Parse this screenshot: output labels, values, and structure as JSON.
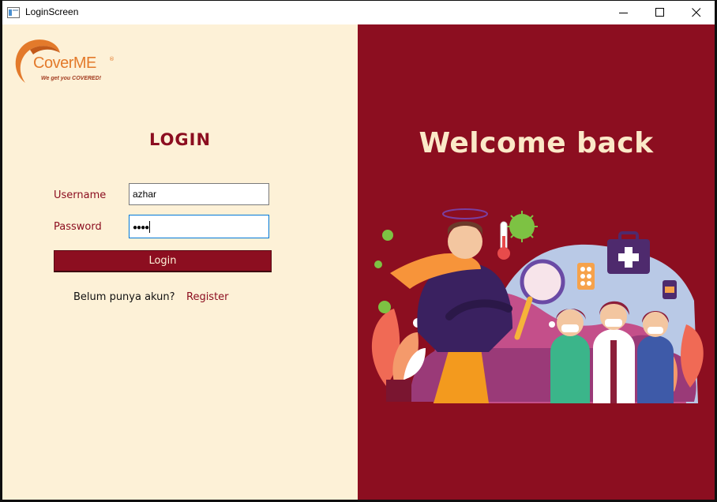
{
  "window": {
    "title": "LoginScreen",
    "controls": [
      "minimize",
      "maximize",
      "close"
    ]
  },
  "brand": {
    "name": "CoverME",
    "registered_mark": "®",
    "tagline": "We get you COVERED!",
    "colors": {
      "orange": "#e37a2b",
      "maroon": "#8c0e20",
      "cream": "#fdf1d7"
    }
  },
  "login_form": {
    "title": "LOGIN",
    "username_label": "Username",
    "username_value": "azhar",
    "password_label": "Password",
    "password_masked": "●●●●",
    "submit_label": "Login",
    "no_account_text": "Belum punya akun?",
    "register_link": "Register"
  },
  "welcome_panel": {
    "heading": "Welcome back",
    "illustration_icons": [
      "sick-person",
      "virus",
      "thermometer",
      "magnifier",
      "pill-pack",
      "first-aid-kit",
      "medicine-bottle",
      "nurse",
      "doctor",
      "plant-leaves"
    ]
  }
}
